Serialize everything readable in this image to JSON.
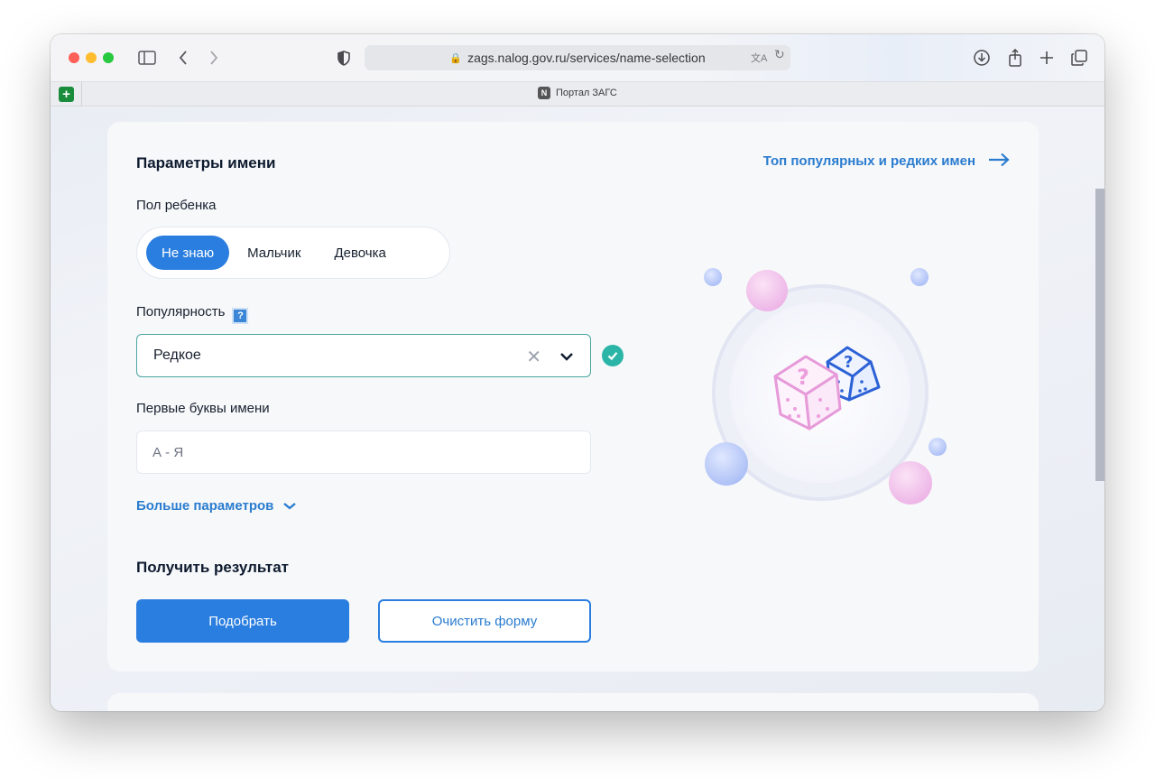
{
  "browser": {
    "url": "zags.nalog.gov.ru/services/name-selection",
    "tab_title": "Портал ЗАГС",
    "tab_favicon_letter": "N"
  },
  "form": {
    "section_title": "Параметры имени",
    "top_link": "Топ популярных и редких имен",
    "gender_label": "Пол ребенка",
    "gender_options": [
      "Не знаю",
      "Мальчик",
      "Девочка"
    ],
    "gender_selected": "Не знаю",
    "popularity_label": "Популярность",
    "popularity_value": "Редкое",
    "letters_label": "Первые буквы имени",
    "letters_placeholder": "А - Я",
    "more_params": "Больше параметров",
    "result_title": "Получить результат",
    "submit_label": "Подобрать",
    "clear_label": "Очистить форму"
  },
  "colors": {
    "accent": "#2a7ee0",
    "link": "#2a7ccf",
    "valid": "#2bb5a7"
  }
}
